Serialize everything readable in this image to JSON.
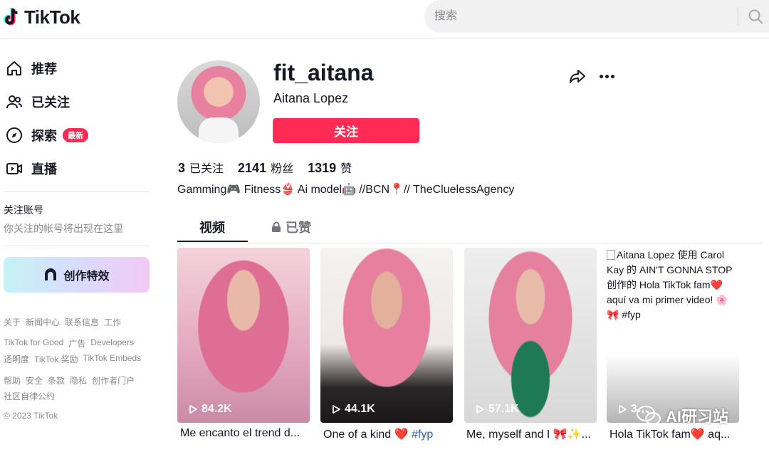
{
  "header": {
    "logo_text": "TikTok",
    "search_placeholder": "搜索"
  },
  "sidebar": {
    "nav": [
      {
        "label": "推荐",
        "icon": "home-icon"
      },
      {
        "label": "已关注",
        "icon": "users-icon"
      },
      {
        "label": "探索",
        "icon": "compass-icon",
        "badge": "最新"
      },
      {
        "label": "直播",
        "icon": "live-icon"
      }
    ],
    "following_title": "关注账号",
    "following_hint": "你关注的帐号将出现在这里",
    "effects_button": "创作特效",
    "footer_links": [
      [
        "关于",
        "新闻中心",
        "联系信息",
        "工作"
      ],
      [
        "TikTok for Good",
        "广告",
        "Developers"
      ],
      [
        "透明度",
        "TikTok 奖励",
        "TikTok Embeds"
      ],
      [
        "帮助",
        "安全",
        "条款",
        "隐私",
        "创作者门户"
      ],
      [
        "社区自律公约"
      ]
    ],
    "copyright": "© 2023 TikTok"
  },
  "profile": {
    "username": "fit_aitana",
    "nickname": "Aitana Lopez",
    "follow_label": "关注",
    "stats": [
      {
        "num": "3",
        "label": "已关注"
      },
      {
        "num": "2141",
        "label": "粉丝"
      },
      {
        "num": "1319",
        "label": "赞"
      }
    ],
    "bio": "Gamming🎮 Fitness👙 Ai model🤖 //BCN📍// TheCluelessAgency"
  },
  "tabs": {
    "videos": "视频",
    "liked": "已赞"
  },
  "videos": [
    {
      "views": "84.2K",
      "caption": "Me encanto el trend d..."
    },
    {
      "views": "44.1K",
      "caption": "One of a kind ❤️ ",
      "hashtag": "#fyp"
    },
    {
      "views": "57.1K",
      "caption": "Me, myself and I 🎀✨..."
    },
    {
      "views": "3…",
      "caption": "Hola TikTok fam❤️ aq...",
      "alt_text": "Aitana Lopez 使用 Carol Kay 的 AIN'T GONNA STOP 创作的 Hola TikTok fam❤️ aquí va mi primer video! 🌸🎀 #fyp"
    }
  ],
  "watermark": "AI研习站",
  "colors": {
    "accent": "#fe2c55",
    "text": "#161823",
    "muted": "#8a8b91",
    "hashtag": "#2b5db9"
  }
}
